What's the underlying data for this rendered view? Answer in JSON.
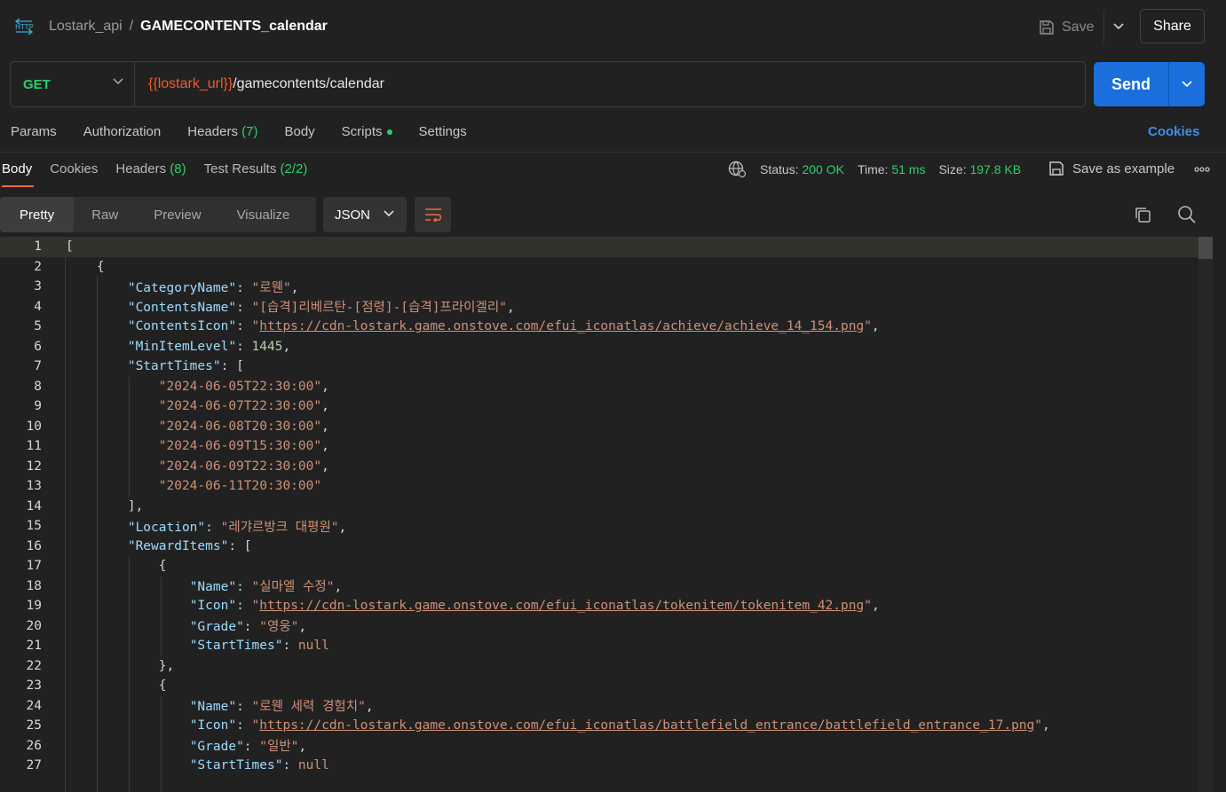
{
  "header": {
    "collection": "Lostark_api",
    "separator": "/",
    "request_name": "GAMECONTENTS_calendar",
    "save_label": "Save",
    "share_label": "Share"
  },
  "request": {
    "method": "GET",
    "url_var": "{{lostark_url}}",
    "url_path": "/gamecontents/calendar",
    "send_label": "Send"
  },
  "request_tabs": {
    "params": "Params",
    "authorization": "Authorization",
    "headers": "Headers",
    "headers_count": "(7)",
    "body": "Body",
    "scripts": "Scripts",
    "settings": "Settings",
    "cookies": "Cookies"
  },
  "response_tabs": {
    "body": "Body",
    "cookies": "Cookies",
    "headers": "Headers",
    "headers_count": "(8)",
    "tests": "Test Results",
    "tests_count": "(2/2)"
  },
  "response_meta": {
    "status_label": "Status:",
    "status_value": "200 OK",
    "time_label": "Time:",
    "time_value": "51 ms",
    "size_label": "Size:",
    "size_value": "197.8 KB",
    "save_example": "Save as example",
    "more": "ooo"
  },
  "view_modes": {
    "pretty": "Pretty",
    "raw": "Raw",
    "preview": "Preview",
    "visualize": "Visualize",
    "format": "JSON"
  },
  "code_lines": [
    {
      "n": "1",
      "parts": [
        [
          "punc",
          "["
        ]
      ]
    },
    {
      "n": "2",
      "parts": [
        [
          "punc",
          "    {"
        ]
      ]
    },
    {
      "n": "3",
      "parts": [
        [
          "punc",
          "        "
        ],
        [
          "key",
          "\"CategoryName\""
        ],
        [
          "punc",
          ": "
        ],
        [
          "str",
          "\"로웬\""
        ],
        [
          "punc",
          ","
        ]
      ]
    },
    {
      "n": "4",
      "parts": [
        [
          "punc",
          "        "
        ],
        [
          "key",
          "\"ContentsName\""
        ],
        [
          "punc",
          ": "
        ],
        [
          "str",
          "\"[습격]리베르탄-[점령]-[습격]프라이겔리\""
        ],
        [
          "punc",
          ","
        ]
      ]
    },
    {
      "n": "5",
      "parts": [
        [
          "punc",
          "        "
        ],
        [
          "key",
          "\"ContentsIcon\""
        ],
        [
          "punc",
          ": "
        ],
        [
          "str",
          "\""
        ],
        [
          "url",
          "https://cdn-lostark.game.onstove.com/efui_iconatlas/achieve/achieve_14_154.png"
        ],
        [
          "str",
          "\""
        ],
        [
          "punc",
          ","
        ]
      ]
    },
    {
      "n": "6",
      "parts": [
        [
          "punc",
          "        "
        ],
        [
          "key",
          "\"MinItemLevel\""
        ],
        [
          "punc",
          ": "
        ],
        [
          "num",
          "1445"
        ],
        [
          "punc",
          ","
        ]
      ]
    },
    {
      "n": "7",
      "parts": [
        [
          "punc",
          "        "
        ],
        [
          "key",
          "\"StartTimes\""
        ],
        [
          "punc",
          ": ["
        ]
      ]
    },
    {
      "n": "8",
      "parts": [
        [
          "punc",
          "            "
        ],
        [
          "str",
          "\"2024-06-05T22:30:00\""
        ],
        [
          "punc",
          ","
        ]
      ]
    },
    {
      "n": "9",
      "parts": [
        [
          "punc",
          "            "
        ],
        [
          "str",
          "\"2024-06-07T22:30:00\""
        ],
        [
          "punc",
          ","
        ]
      ]
    },
    {
      "n": "10",
      "parts": [
        [
          "punc",
          "            "
        ],
        [
          "str",
          "\"2024-06-08T20:30:00\""
        ],
        [
          "punc",
          ","
        ]
      ]
    },
    {
      "n": "11",
      "parts": [
        [
          "punc",
          "            "
        ],
        [
          "str",
          "\"2024-06-09T15:30:00\""
        ],
        [
          "punc",
          ","
        ]
      ]
    },
    {
      "n": "12",
      "parts": [
        [
          "punc",
          "            "
        ],
        [
          "str",
          "\"2024-06-09T22:30:00\""
        ],
        [
          "punc",
          ","
        ]
      ]
    },
    {
      "n": "13",
      "parts": [
        [
          "punc",
          "            "
        ],
        [
          "str",
          "\"2024-06-11T20:30:00\""
        ]
      ]
    },
    {
      "n": "14",
      "parts": [
        [
          "punc",
          "        ],"
        ]
      ]
    },
    {
      "n": "15",
      "parts": [
        [
          "punc",
          "        "
        ],
        [
          "key",
          "\"Location\""
        ],
        [
          "punc",
          ": "
        ],
        [
          "str",
          "\"레갸르방크 대평원\""
        ],
        [
          "punc",
          ","
        ]
      ]
    },
    {
      "n": "16",
      "parts": [
        [
          "punc",
          "        "
        ],
        [
          "key",
          "\"RewardItems\""
        ],
        [
          "punc",
          ": ["
        ]
      ]
    },
    {
      "n": "17",
      "parts": [
        [
          "punc",
          "            {"
        ]
      ]
    },
    {
      "n": "18",
      "parts": [
        [
          "punc",
          "                "
        ],
        [
          "key",
          "\"Name\""
        ],
        [
          "punc",
          ": "
        ],
        [
          "str",
          "\"실마엘 수정\""
        ],
        [
          "punc",
          ","
        ]
      ]
    },
    {
      "n": "19",
      "parts": [
        [
          "punc",
          "                "
        ],
        [
          "key",
          "\"Icon\""
        ],
        [
          "punc",
          ": "
        ],
        [
          "str",
          "\""
        ],
        [
          "url",
          "https://cdn-lostark.game.onstove.com/efui_iconatlas/tokenitem/tokenitem_42.png"
        ],
        [
          "str",
          "\""
        ],
        [
          "punc",
          ","
        ]
      ]
    },
    {
      "n": "20",
      "parts": [
        [
          "punc",
          "                "
        ],
        [
          "key",
          "\"Grade\""
        ],
        [
          "punc",
          ": "
        ],
        [
          "str",
          "\"영웅\""
        ],
        [
          "punc",
          ","
        ]
      ]
    },
    {
      "n": "21",
      "parts": [
        [
          "punc",
          "                "
        ],
        [
          "key",
          "\"StartTimes\""
        ],
        [
          "punc",
          ": "
        ],
        [
          "kw",
          "null"
        ]
      ]
    },
    {
      "n": "22",
      "parts": [
        [
          "punc",
          "            },"
        ]
      ]
    },
    {
      "n": "23",
      "parts": [
        [
          "punc",
          "            {"
        ]
      ]
    },
    {
      "n": "24",
      "parts": [
        [
          "punc",
          "                "
        ],
        [
          "key",
          "\"Name\""
        ],
        [
          "punc",
          ": "
        ],
        [
          "str",
          "\"로웬 세력 경험치\""
        ],
        [
          "punc",
          ","
        ]
      ]
    },
    {
      "n": "25",
      "parts": [
        [
          "punc",
          "                "
        ],
        [
          "key",
          "\"Icon\""
        ],
        [
          "punc",
          ": "
        ],
        [
          "str",
          "\""
        ],
        [
          "url",
          "https://cdn-lostark.game.onstove.com/efui_iconatlas/battlefield_entrance/battlefield_entrance_17.png"
        ],
        [
          "str",
          "\""
        ],
        [
          "punc",
          ","
        ]
      ]
    },
    {
      "n": "26",
      "parts": [
        [
          "punc",
          "                "
        ],
        [
          "key",
          "\"Grade\""
        ],
        [
          "punc",
          ": "
        ],
        [
          "str",
          "\"일반\""
        ],
        [
          "punc",
          ","
        ]
      ]
    },
    {
      "n": "27",
      "parts": [
        [
          "punc",
          "                "
        ],
        [
          "key",
          "\"StartTimes\""
        ],
        [
          "punc",
          ": "
        ],
        [
          "kw",
          "null"
        ]
      ]
    }
  ]
}
